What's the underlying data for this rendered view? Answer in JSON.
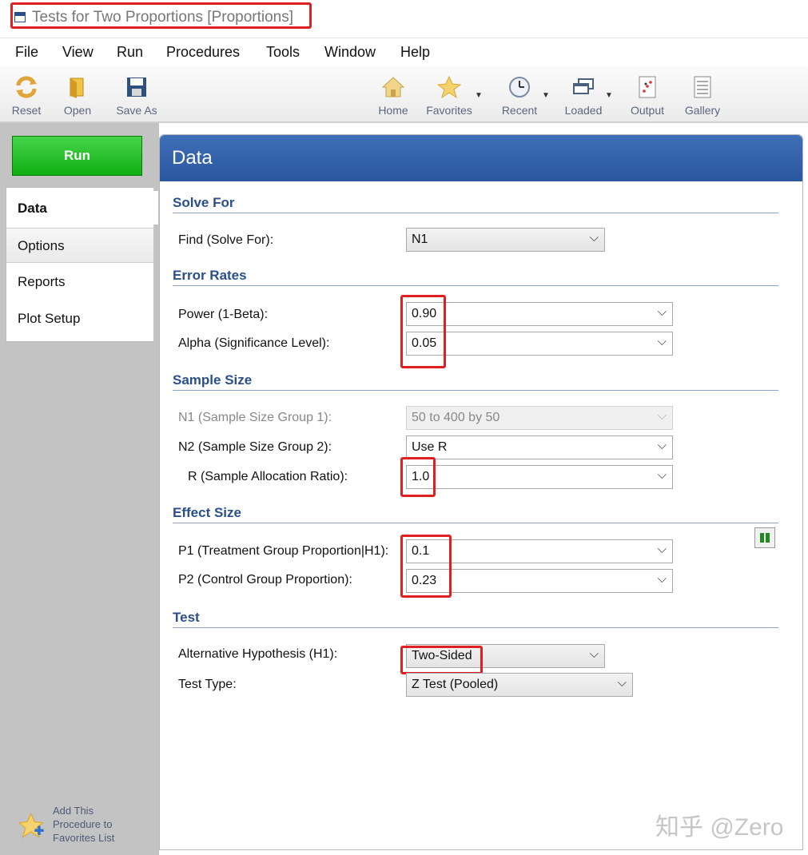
{
  "window": {
    "title": "Tests for Two Proportions [Proportions]"
  },
  "menu": [
    "File",
    "View",
    "Run",
    "Procedures",
    "Tools",
    "Window",
    "Help"
  ],
  "toolbar": {
    "reset": "Reset",
    "open": "Open",
    "save_as": "Save As",
    "home": "Home",
    "favorites": "Favorites",
    "recent": "Recent",
    "loaded": "Loaded",
    "output": "Output",
    "gallery": "Gallery"
  },
  "sidebar": {
    "run": "Run",
    "tabs": [
      "Data",
      "Options",
      "Reports",
      "Plot Setup"
    ],
    "add_favorites": [
      "Add This",
      "Procedure to",
      "Favorites List"
    ]
  },
  "panel": {
    "title": "Data"
  },
  "sections": {
    "solve_for": "Solve For",
    "error_rates": "Error Rates",
    "sample_size": "Sample Size",
    "effect_size": "Effect Size",
    "test": "Test"
  },
  "fields": {
    "find": {
      "label": "Find (Solve For):",
      "value": "N1"
    },
    "power": {
      "label": "Power (1-Beta):",
      "value": "0.90"
    },
    "alpha": {
      "label": "Alpha (Significance Level):",
      "value": "0.05"
    },
    "n1": {
      "label": "N1 (Sample Size Group 1):",
      "value": "50 to 400 by 50"
    },
    "n2": {
      "label": "N2 (Sample Size Group 2):",
      "value": "Use R"
    },
    "r": {
      "label": "R (Sample Allocation Ratio):",
      "value": "1.0"
    },
    "p1": {
      "label": "P1 (Treatment Group Proportion|H1):",
      "value": "0.1"
    },
    "p2": {
      "label": "P2 (Control Group Proportion):",
      "value": "0.23"
    },
    "h1": {
      "label": "Alternative Hypothesis (H1):",
      "value": "Two-Sided"
    },
    "test_type": {
      "label": "Test Type:",
      "value": "Z Test (Pooled)"
    }
  },
  "watermark": "知乎 @Zero",
  "colors": {
    "accent": "#2b579f",
    "run": "#0fae12",
    "highlight": "#e02020"
  }
}
